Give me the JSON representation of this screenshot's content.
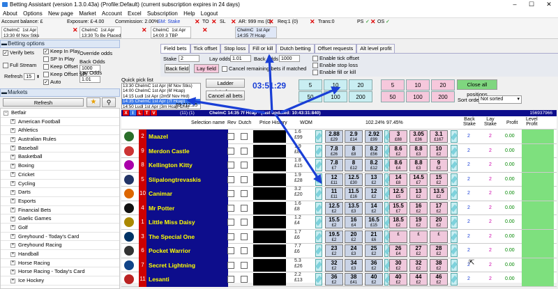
{
  "window": {
    "title": "Betting Assistant (version 1.3.0.43a)    (Profile:Default)    (current subscription expires in 24 days)",
    "min": "–",
    "max": "☐",
    "close": "✕"
  },
  "menu": [
    "About",
    "Options",
    "New page",
    "Market",
    "Account",
    "Excel",
    "Subscription",
    "Help",
    "Logout"
  ],
  "toolbar": {
    "balance": "Account balance: £",
    "exposure": "Exposure: £-4.00",
    "commission": "Commission: 2.00%",
    "sm": "SM: Stake",
    "to": "TO",
    "sl": "SL",
    "ar": "AR: 999 ms (0)",
    "req": "Req:1 (0)",
    "trans": "Trans:0",
    "ps": "PS",
    "os": "OS",
    "mkt1": "ChelmC  1st Apr\n13:30 6f Nov Stks",
    "mkt2": "ChelmC  1st Apr\n13:30 To Be Placed",
    "mkt3": "ChelmC  1st Apr\n14:00 3 TBP",
    "mkt4": "ChelmC  1st Apr\n14:35 7f Hcap"
  },
  "betting_options": {
    "header": "Betting options",
    "verify": "Verify bets",
    "full_stream": "Full Stream",
    "refresh_label": "Refresh",
    "refresh_value": "15",
    "auto": "Auto",
    "keep_in_play": "Keep In Play",
    "sp_in_play": "SP In Play",
    "keep_offset_ip": "Keep Offset IP",
    "keep_offset_sp": "Keep Offset SP",
    "override": "Override odds",
    "back_odds": "Back Odds",
    "back_odds_val": "1000",
    "lay_odds": "Lay Odds",
    "lay_odds_val": "1.01",
    "active1": "Active",
    "active2": "Active"
  },
  "markets": {
    "header": "Markets",
    "refresh": "Refresh",
    "root": "Betfair",
    "items": [
      "American Football",
      "Athletics",
      "Australian Rules",
      "Baseball",
      "Basketball",
      "Boxing",
      "Cricket",
      "Cycling",
      "Darts",
      "Esports",
      "Financial Bets",
      "Gaelic Games",
      "Golf",
      "Greyhound - Today's Card",
      "Greyhound Racing",
      "Handball",
      "Horse Racing",
      "Horse Racing - Today's Card",
      "Ice Hockey"
    ]
  },
  "quickpick": {
    "label": "Quick pick list",
    "items": [
      "13:30 ChelmC 1st Apr (6f Nov Stks)",
      "14:00 ChelmC 1st Apr (6f Hcap)",
      "14:15 Ludl 1st Apr (2m5f Nov Hrd)",
      "14:35 ChelmC 1st Apr (7f Hcap)",
      "14:50 Ludl 1st Apr (3m Hcap Chs)"
    ],
    "selected": 3,
    "extra": "69,712.25"
  },
  "tabs": [
    "Field bets",
    "Tick offset",
    "Stop loss",
    "Fill or kill",
    "Dutch betting",
    "Offset requests",
    "Alt level profit"
  ],
  "fieldbets": {
    "stake_label": "Stake",
    "stake_val": "2",
    "layodds_label": "Lay odds",
    "layodds_val": "1.01",
    "backodds_label": "Back odds",
    "backodds_val": "1000",
    "back_field": "Back field",
    "lay_field": "Lay field",
    "cancel_remaining": "Cancel remaining bets if matched",
    "enable_tick": "Enable tick offset",
    "enable_stop": "Enable stop loss",
    "enable_fill": "Enable fill or kill"
  },
  "controls": {
    "ladder": "Ladder interface",
    "cancel_all": "Cancel all bets",
    "timer": "03:51:29",
    "back_stakes": [
      "5",
      "10",
      "20",
      "50",
      "100",
      "200"
    ],
    "lay_stakes": [
      "5",
      "10",
      "20",
      "50",
      "100",
      "200"
    ],
    "close_all": "Close all positions",
    "sort_label": "Sort order",
    "sort_value": "Not sorted"
  },
  "grid": {
    "market_title": "ChelmC  14:35 7f Hcap - (last updated: 10:43:31:840)",
    "count": "(11) (1)",
    "market_id": "156937966",
    "flags": [
      "X",
      "I",
      "L",
      "T",
      "V"
    ],
    "headers": {
      "selection": "Selection name",
      "rev": "Rev",
      "dutch": "Dutch",
      "history": "Price History",
      "wom": "WOM",
      "pct_back": "102.24%",
      "pct_lay": "97.45%",
      "back_stake": "Back\nStake",
      "lay_stake": "Lay\nStake",
      "profit": "Profit",
      "level": "Level\nProfit"
    },
    "runners": [
      {
        "no": "2",
        "name": "Maazel",
        "wom": [
          "1.6",
          "£99"
        ],
        "back": [
          [
            "2.88",
            "£29"
          ],
          [
            "2.9",
            "£14"
          ],
          [
            "2.92",
            "£99"
          ]
        ],
        "lay": [
          [
            "3",
            "£88"
          ],
          [
            "3.05",
            "£36"
          ],
          [
            "3.1",
            "£167"
          ]
        ],
        "bs": "2",
        "ls": "2",
        "profit": "0.00",
        "silk": "#2a6e2a"
      },
      {
        "no": "9",
        "name": "Merdon Castle",
        "wom": [
          "1.9",
          "£8"
        ],
        "back": [
          [
            "7.8",
            "£26"
          ],
          [
            "8",
            "£8"
          ],
          [
            "8.2",
            "£56"
          ]
        ],
        "lay": [
          [
            "8.6",
            "£2"
          ],
          [
            "8.8",
            "£3"
          ],
          [
            "10",
            "£2"
          ]
        ],
        "bs": "2",
        "ls": "2",
        "profit": "0.00",
        "silk": "#c33"
      },
      {
        "no": "8",
        "name": "Kellington Kitty",
        "wom": [
          "1.8",
          "£15"
        ],
        "back": [
          [
            "7.8",
            "£7"
          ],
          [
            "8",
            "£12"
          ],
          [
            "8.2",
            "£12"
          ]
        ],
        "lay": [
          [
            "8.6",
            "£4"
          ],
          [
            "8.8",
            "£3"
          ],
          [
            "9",
            "£2"
          ]
        ],
        "bs": "2",
        "ls": "2",
        "profit": "0.00",
        "silk": "#a0a"
      },
      {
        "no": "5",
        "name": "Slipalongtrevaskis",
        "wom": [
          "1.9",
          "£28"
        ],
        "back": [
          [
            "12",
            "£11"
          ],
          [
            "12.5",
            "£30"
          ],
          [
            "13",
            "£2"
          ]
        ],
        "lay": [
          [
            "14",
            "£8"
          ],
          [
            "14.5",
            "£7"
          ],
          [
            "15",
            "£2"
          ]
        ],
        "bs": "2",
        "ls": "2",
        "profit": "0.00",
        "silk": "#236"
      },
      {
        "no": "10",
        "name": "Canimar",
        "wom": [
          "3.2",
          "£20"
        ],
        "back": [
          [
            "11",
            "£11"
          ],
          [
            "11.5",
            "£16"
          ],
          [
            "12",
            "£2"
          ]
        ],
        "lay": [
          [
            "12.5",
            "£5"
          ],
          [
            "13",
            "£2"
          ],
          [
            "13.5",
            "£2"
          ]
        ],
        "bs": "2",
        "ls": "2",
        "profit": "0.00",
        "silk": "#d60"
      },
      {
        "no": "4",
        "name": "Mr Potter",
        "wom": [
          "1.6",
          "£8"
        ],
        "back": [
          [
            "12.5",
            "£2"
          ],
          [
            "13.5",
            "£3"
          ],
          [
            "14",
            "£2"
          ]
        ],
        "lay": [
          [
            "15.5",
            "£7"
          ],
          [
            "16",
            "£2"
          ],
          [
            "17",
            "£2"
          ]
        ],
        "bs": "2",
        "ls": "2",
        "profit": "0.00",
        "silk": "#111"
      },
      {
        "no": "1",
        "name": "Little Miss Daisy",
        "wom": [
          "1.2",
          "£4"
        ],
        "back": [
          [
            "15.5",
            "£2"
          ],
          [
            "16",
            "£4"
          ],
          [
            "16.5",
            "£15"
          ]
        ],
        "lay": [
          [
            "18.5",
            "£2"
          ],
          [
            "19",
            "£2"
          ],
          [
            "20",
            "£2"
          ]
        ],
        "bs": "2",
        "ls": "2",
        "profit": "0.00",
        "silk": "#a80"
      },
      {
        "no": "3",
        "name": "The Special One",
        "wom": [
          "1.7",
          "£6"
        ],
        "back": [
          [
            "19.5",
            "£2"
          ],
          [
            "20",
            "£2"
          ],
          [
            "21",
            "£6"
          ]
        ],
        "lay": [
          [
            "",
            "£"
          ],
          [
            "",
            "£"
          ],
          [
            "",
            "£"
          ]
        ],
        "bs": "2",
        "ls": "2",
        "profit": "0.00",
        "silk": "#036"
      },
      {
        "no": "6",
        "name": "Pocket Warrior",
        "wom": [
          "7.7",
          "£6"
        ],
        "back": [
          [
            "23",
            "£2"
          ],
          [
            "24",
            "£3"
          ],
          [
            "25",
            "£2"
          ]
        ],
        "lay": [
          [
            "26",
            "£4"
          ],
          [
            "27",
            "£2"
          ],
          [
            "28",
            "£2"
          ]
        ],
        "bs": "2",
        "ls": "2",
        "profit": "0.00",
        "silk": "#333"
      },
      {
        "no": "7",
        "name": "Secret Lightning",
        "wom": [
          "5.3",
          "£26"
        ],
        "back": [
          [
            "32",
            "£2"
          ],
          [
            "34",
            "£3"
          ],
          [
            "36",
            "£2"
          ]
        ],
        "lay": [
          [
            "30",
            "£2"
          ],
          [
            "32",
            "£2"
          ],
          [
            "38",
            "£2"
          ]
        ],
        "bs": "2",
        "ls": "2",
        "profit": "0.00",
        "silk": "#148"
      },
      {
        "no": "11",
        "name": "Lesanti",
        "wom": [
          "2.2",
          "£13"
        ],
        "back": [
          [
            "36",
            "£2"
          ],
          [
            "38",
            "£41"
          ],
          [
            "40",
            "£2"
          ]
        ],
        "lay": [
          [
            "40",
            "£2"
          ],
          [
            "44",
            "£2"
          ],
          [
            "46",
            "£2"
          ]
        ],
        "bs": "2",
        "ls": "2",
        "profit": "0.00",
        "silk": "#b22"
      }
    ]
  }
}
